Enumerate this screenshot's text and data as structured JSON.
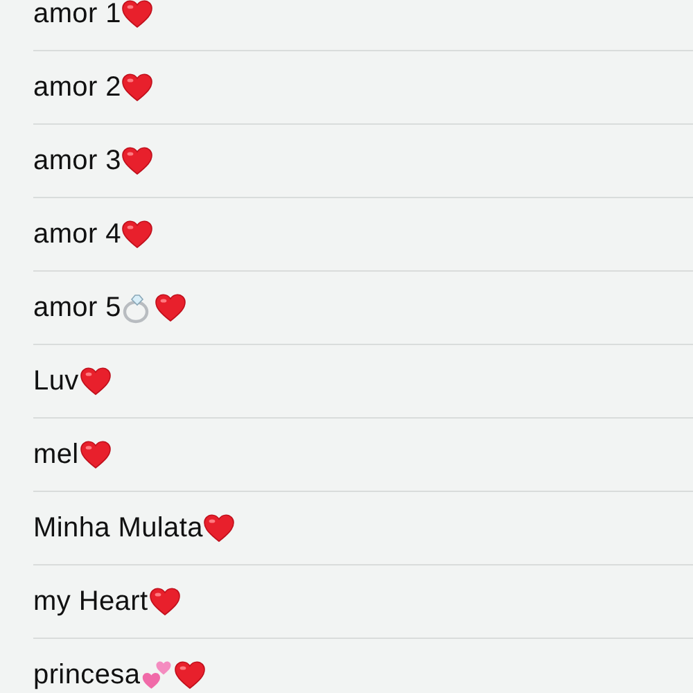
{
  "contacts": [
    {
      "name": "amor 1",
      "emoji": [
        {
          "kind": "heart"
        }
      ]
    },
    {
      "name": "amor 2",
      "emoji": [
        {
          "kind": "heart"
        }
      ]
    },
    {
      "name": "amor 3",
      "emoji": [
        {
          "kind": "heart"
        }
      ]
    },
    {
      "name": "amor 4",
      "emoji": [
        {
          "kind": "heart"
        }
      ]
    },
    {
      "name": "amor 5",
      "emoji": [
        {
          "kind": "ring"
        },
        {
          "kind": "heart"
        }
      ]
    },
    {
      "name": "Luv",
      "emoji": [
        {
          "kind": "heart"
        }
      ]
    },
    {
      "name": "mel",
      "emoji": [
        {
          "kind": "heart"
        }
      ]
    },
    {
      "name": "Minha Mulata",
      "emoji": [
        {
          "kind": "heart"
        }
      ]
    },
    {
      "name": "my Heart",
      "emoji": [
        {
          "kind": "heart"
        }
      ]
    },
    {
      "name": "princesa",
      "emoji": [
        {
          "kind": "two-hearts"
        },
        {
          "kind": "heart"
        }
      ]
    }
  ]
}
